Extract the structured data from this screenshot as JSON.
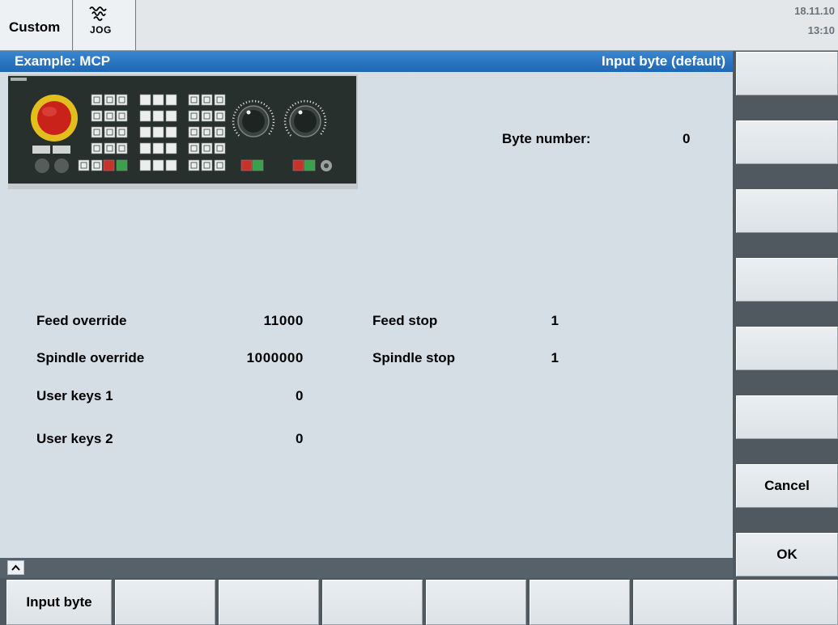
{
  "header": {
    "operating_area": "Custom",
    "mode": "JOG",
    "date": "18.11.10",
    "time": "13:10"
  },
  "title_bar": {
    "title": "Example: MCP",
    "subtitle": "Input byte (default)"
  },
  "byte_number": {
    "label": "Byte number:",
    "value": "0"
  },
  "signals_left": [
    {
      "label": "Feed override",
      "value": "11000"
    },
    {
      "label": "Spindle override",
      "value": "1000000"
    },
    {
      "label": "User keys 1",
      "value": "0"
    },
    {
      "label": "User keys 2",
      "value": "0"
    }
  ],
  "signals_right": [
    {
      "label": "Feed stop",
      "value": "1"
    },
    {
      "label": "Spindle stop",
      "value": "1"
    }
  ],
  "vertical_softkeys": [
    "",
    "",
    "",
    "",
    "",
    "",
    "Cancel",
    "OK"
  ],
  "horizontal_softkeys": [
    "Input byte",
    "",
    "",
    "",
    "",
    "",
    "",
    ""
  ],
  "icons": {
    "operating_mode": "jog-icon",
    "softkey_toggle": "chevron-up-icon"
  },
  "colors": {
    "header_background": "#e3e7ea",
    "title_bar": "#1f67b3",
    "content_background": "#d6dee5",
    "softkey_face": "#dde2e6",
    "softkey_gap": "#4f595f",
    "date_text": "#69737a",
    "emergency_stop": "#c8221b",
    "emergency_stop_ring": "#e3bf1d"
  }
}
